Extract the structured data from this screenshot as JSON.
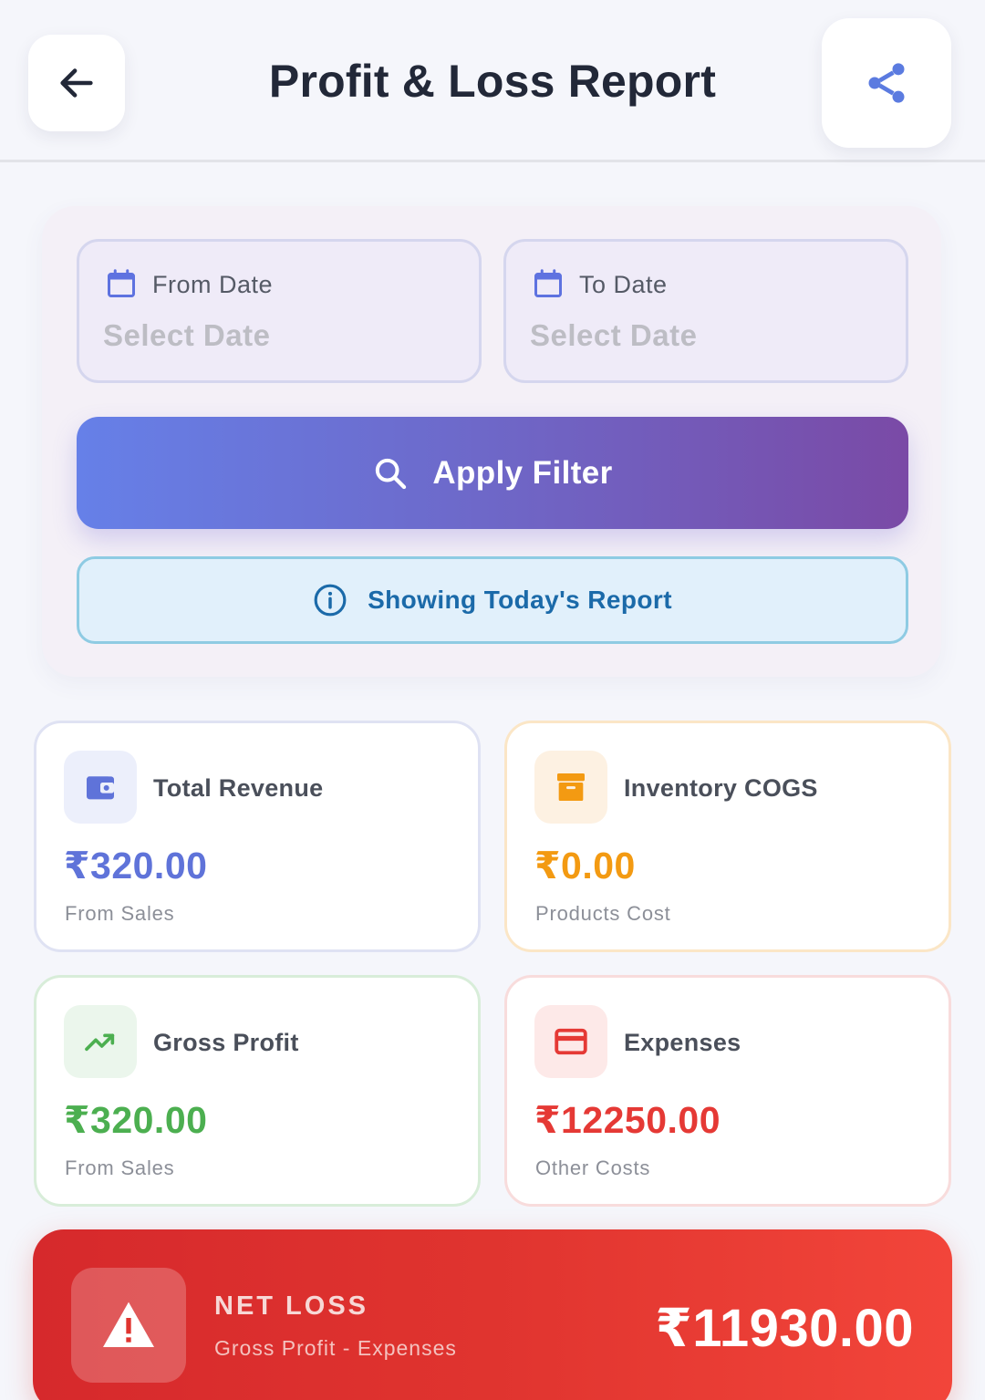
{
  "header": {
    "title": "Profit & Loss Report",
    "back_icon": "arrow-left-icon",
    "share_icon": "share-icon"
  },
  "filter": {
    "from_date": {
      "label": "From Date",
      "placeholder": "Select Date"
    },
    "to_date": {
      "label": "To Date",
      "placeholder": "Select Date"
    },
    "apply_label": "Apply Filter",
    "info_text": "Showing Today's Report"
  },
  "stats": {
    "total_revenue": {
      "label": "Total Revenue",
      "amount": "₹320.00",
      "sub": "From Sales",
      "color": "#5f73d9",
      "icon": "wallet-icon"
    },
    "inventory_cogs": {
      "label": "Inventory COGS",
      "amount": "₹0.00",
      "sub": "Products Cost",
      "color": "#f39a12",
      "icon": "archive-box-icon"
    },
    "gross_profit": {
      "label": "Gross Profit",
      "amount": "₹320.00",
      "sub": "From Sales",
      "color": "#4caf50",
      "icon": "trending-up-icon"
    },
    "expenses": {
      "label": "Expenses",
      "amount": "₹12250.00",
      "sub": "Other Costs",
      "color": "#e53935",
      "icon": "credit-card-icon"
    }
  },
  "net": {
    "title": "NET LOSS",
    "sub": "Gross Profit - Expenses",
    "amount": "₹11930.00",
    "icon": "warning-icon"
  },
  "colors": {
    "accent": "#6d6acb",
    "info": "#1b6aa9",
    "loss": "#e0342f"
  }
}
